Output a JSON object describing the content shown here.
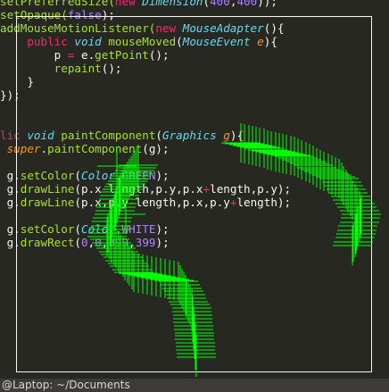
{
  "editor": {
    "lines": [
      [
        {
          "t": "setPreferredSize(",
          "c": "fn"
        },
        {
          "t": "new ",
          "c": "kw"
        },
        {
          "t": "Dimension",
          "c": "tp"
        },
        {
          "t": "(",
          "c": "pl"
        },
        {
          "t": "400",
          "c": "nm"
        },
        {
          "t": ",",
          "c": "pl"
        },
        {
          "t": "400",
          "c": "nm"
        },
        {
          "t": "));",
          "c": "pl"
        }
      ],
      [
        {
          "t": "setOpaque(",
          "c": "fn"
        },
        {
          "t": "false",
          "c": "nm"
        },
        {
          "t": ");",
          "c": "pl"
        }
      ],
      [
        {
          "t": "addMouseMotionListener(",
          "c": "fn"
        },
        {
          "t": "new ",
          "c": "kw"
        },
        {
          "t": "MouseAdapter",
          "c": "tp"
        },
        {
          "t": "(){",
          "c": "pl"
        }
      ],
      [
        {
          "t": "    ",
          "c": "pl"
        },
        {
          "t": "public ",
          "c": "kw"
        },
        {
          "t": "void ",
          "c": "tp"
        },
        {
          "t": "mouseMoved",
          "c": "fn"
        },
        {
          "t": "(",
          "c": "pl"
        },
        {
          "t": "MouseEvent ",
          "c": "tp"
        },
        {
          "t": "e",
          "c": "pa"
        },
        {
          "t": "){",
          "c": "pl"
        }
      ],
      [
        {
          "t": "        p ",
          "c": "pl"
        },
        {
          "t": "=",
          "c": "kw"
        },
        {
          "t": " e.",
          "c": "pl"
        },
        {
          "t": "getPoint",
          "c": "fn"
        },
        {
          "t": "();",
          "c": "pl"
        }
      ],
      [
        {
          "t": "        ",
          "c": "pl"
        },
        {
          "t": "repaint",
          "c": "fn"
        },
        {
          "t": "();",
          "c": "pl"
        }
      ],
      [
        {
          "t": "    }",
          "c": "pl"
        }
      ],
      [
        {
          "t": "});",
          "c": "pl"
        }
      ],
      [],
      [],
      [
        {
          "t": "lic ",
          "c": "kw"
        },
        {
          "t": "void ",
          "c": "tp"
        },
        {
          "t": "paintComponent",
          "c": "fn"
        },
        {
          "t": "(",
          "c": "pl"
        },
        {
          "t": "Graphics ",
          "c": "tp"
        },
        {
          "t": "g",
          "c": "pa"
        },
        {
          "t": "){",
          "c": "pl"
        }
      ],
      [
        {
          "t": " ",
          "c": "pl"
        },
        {
          "t": "super",
          "c": "sp"
        },
        {
          "t": ".",
          "c": "pl"
        },
        {
          "t": "paintComponent",
          "c": "fn"
        },
        {
          "t": "(g);",
          "c": "pl"
        }
      ],
      [],
      [
        {
          "t": " g.",
          "c": "pl"
        },
        {
          "t": "setColor",
          "c": "fn"
        },
        {
          "t": "(",
          "c": "pl"
        },
        {
          "t": "Color",
          "c": "tp"
        },
        {
          "t": ".",
          "c": "pl"
        },
        {
          "t": "GREEN",
          "c": "nm"
        },
        {
          "t": ");",
          "c": "pl"
        }
      ],
      [
        {
          "t": " g.",
          "c": "pl"
        },
        {
          "t": "drawLine",
          "c": "fn"
        },
        {
          "t": "(p.x",
          "c": "pl"
        },
        {
          "t": "-",
          "c": "kw"
        },
        {
          "t": "length,p.y,p.x",
          "c": "pl"
        },
        {
          "t": "+",
          "c": "kw"
        },
        {
          "t": "length,p.y);",
          "c": "pl"
        }
      ],
      [
        {
          "t": " g.",
          "c": "pl"
        },
        {
          "t": "drawLine",
          "c": "fn"
        },
        {
          "t": "(p.x,p.y",
          "c": "pl"
        },
        {
          "t": "-",
          "c": "kw"
        },
        {
          "t": "length,p.x,p.y",
          "c": "pl"
        },
        {
          "t": "+",
          "c": "kw"
        },
        {
          "t": "length);",
          "c": "pl"
        }
      ],
      [],
      [
        {
          "t": " g.",
          "c": "pl"
        },
        {
          "t": "setColor",
          "c": "fn"
        },
        {
          "t": "(",
          "c": "pl"
        },
        {
          "t": "Color",
          "c": "tp"
        },
        {
          "t": ".",
          "c": "pl"
        },
        {
          "t": "WHITE",
          "c": "nm"
        },
        {
          "t": ");",
          "c": "pl"
        }
      ],
      [
        {
          "t": " g.",
          "c": "pl"
        },
        {
          "t": "drawRect",
          "c": "fn"
        },
        {
          "t": "(",
          "c": "pl"
        },
        {
          "t": "0",
          "c": "nm"
        },
        {
          "t": ",",
          "c": "pl"
        },
        {
          "t": "0",
          "c": "nm"
        },
        {
          "t": ",",
          "c": "pl"
        },
        {
          "t": "399",
          "c": "nm"
        },
        {
          "t": ",",
          "c": "pl"
        },
        {
          "t": "399",
          "c": "nm"
        },
        {
          "t": ");",
          "c": "pl"
        }
      ]
    ]
  },
  "statusbar": {
    "text": "@Laptop: ~/Documents"
  },
  "colors": {
    "background": "#272822",
    "crosshair": "#00ff00",
    "frame": "#f8f8f2"
  }
}
